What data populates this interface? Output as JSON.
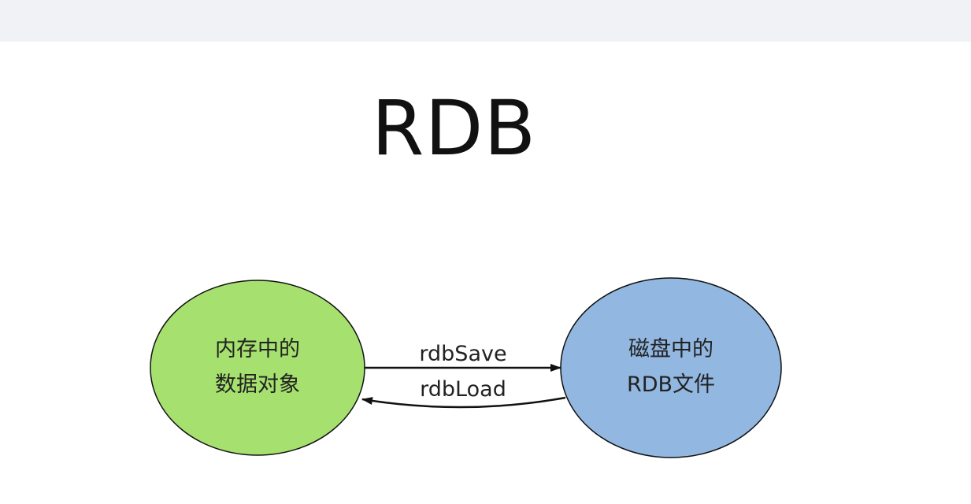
{
  "title": "RDB",
  "nodes": {
    "memory": {
      "line1": "内存中的",
      "line2": "数据对象",
      "fill": "#a6e16f"
    },
    "disk": {
      "line1": "磁盘中的",
      "line2": "RDB文件",
      "fill": "#92b7e1"
    }
  },
  "edges": {
    "save": {
      "label": "rdbSave"
    },
    "load": {
      "label": "rdbLoad"
    }
  }
}
